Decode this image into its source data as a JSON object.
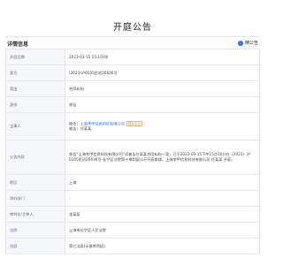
{
  "page": {
    "title": "开庭公告"
  },
  "section": {
    "label": "详情信息",
    "notice_link": "精公告",
    "notice_icon": "info-icon"
  },
  "fields": {
    "court_date": {
      "key": "开庭日期",
      "value": "2023-03-15 15:10:00"
    },
    "case_no": {
      "key": "案号",
      "value": "(2023)沪0105民初26636号"
    },
    "cause": {
      "key": "案由",
      "value": "合同纠纷"
    },
    "identity": {
      "key": "身份",
      "value": "原告"
    },
    "parties": {
      "key": "当事人",
      "plaintiff_prefix": "原告：",
      "plaintiff_name": "上海李甲信息科技有限公司",
      "plaintiff_tag": "疑似企业",
      "defendant_prefix": "被告：",
      "defendant_name": "任某某"
    },
    "content": {
      "key": "公告内容",
      "value": "原告“上海李甲信息科技有限公司”诉被告任某某合同纠纷一案，已于2023-03-15下午15点10分在（2023）沪0105民初26636号-长宁区法院第十审判庭公开开庭审理。上海李甲信息科技有限公司 任某某 开庭。"
    },
    "region": {
      "key": "地区",
      "value": "上海"
    },
    "department": {
      "key": "承办部门",
      "value": "-"
    },
    "judge": {
      "key": "审判长/主审人",
      "value": "张某某"
    },
    "court": {
      "key": "法院",
      "value": "上海市长宁区人民法院"
    },
    "courtroom": {
      "key": "法庭",
      "value": "第七法庭(示意审判庭)"
    }
  },
  "colors": {
    "link": "#1e6fd9",
    "tag": "#e88a3a",
    "key_bg": "#f5f7fa",
    "border": "#e8e8e8"
  }
}
